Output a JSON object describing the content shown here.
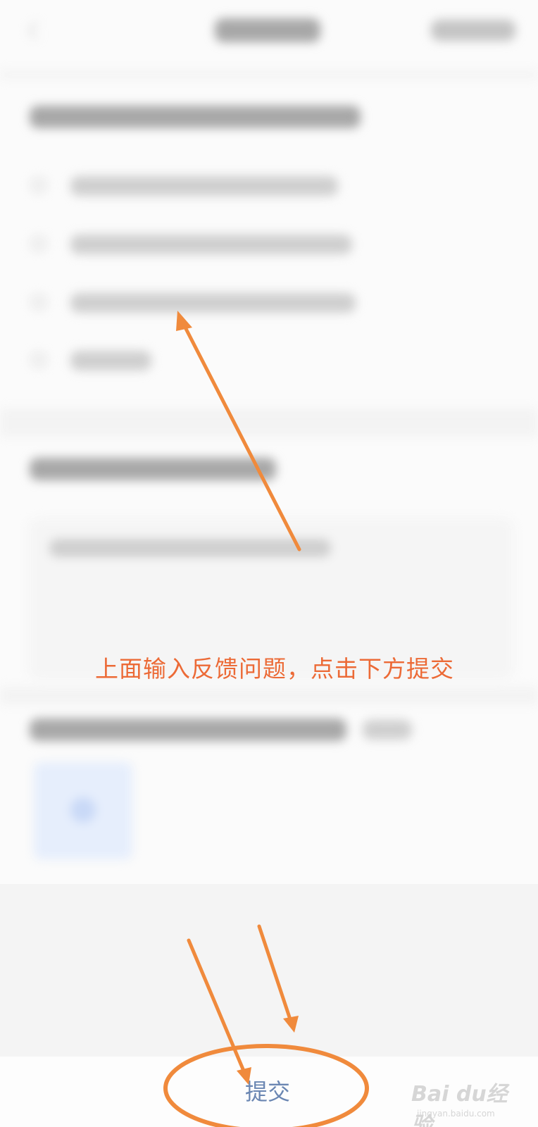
{
  "annotation": {
    "caption": "上面输入反馈问题，点击下方提交",
    "accent_color": "#f08a3c"
  },
  "footer": {
    "submit_label": "提交"
  },
  "watermark": {
    "main": "Bai du经验",
    "sub": "jingyan.baidu.com"
  },
  "icons": [
    "back-chevron-icon",
    "upload-plus-icon"
  ]
}
